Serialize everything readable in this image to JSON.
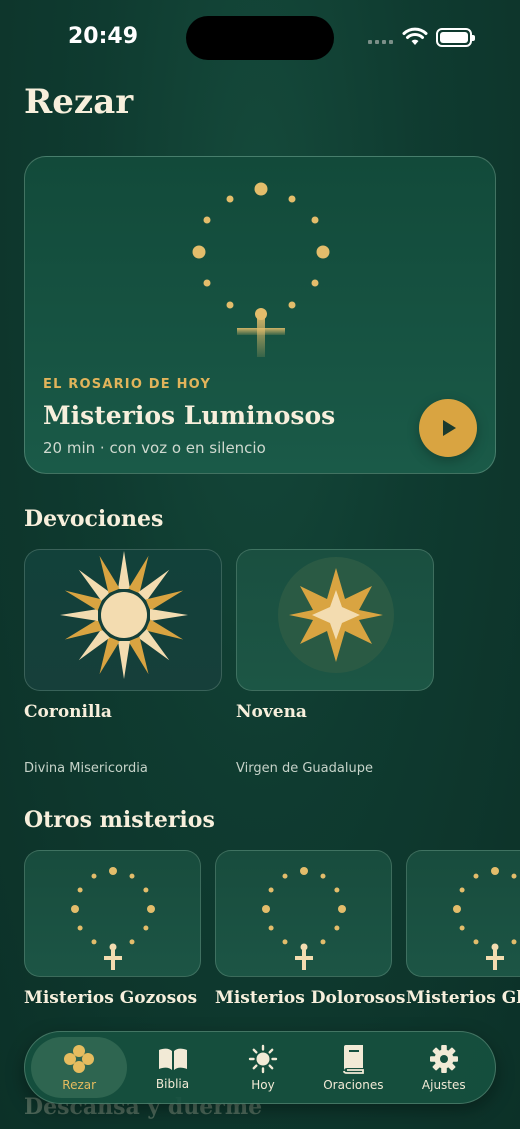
{
  "status_bar": {
    "time": "20:49"
  },
  "page": {
    "title": "Rezar"
  },
  "hero": {
    "kicker": "EL ROSARIO DE HOY",
    "title": "Misterios Luminosos",
    "subtitle": "20 min · con voz o en silencio",
    "play_icon": "play-icon"
  },
  "devociones": {
    "title": "Devociones",
    "items": [
      {
        "name": "Coronilla",
        "subtitle": "Divina Misericordia",
        "icon": "sunburst-icon"
      },
      {
        "name": "Novena",
        "subtitle": "Virgen de Guadalupe",
        "icon": "star-icon"
      }
    ]
  },
  "otros": {
    "title": "Otros misterios",
    "items": [
      {
        "name": "Misterios Gozosos"
      },
      {
        "name": "Misterios Dolorosos"
      },
      {
        "name": "Misterios Glo"
      }
    ]
  },
  "below_fold": {
    "title": "Descansa y duerme"
  },
  "tab_bar": {
    "items": [
      {
        "label": "Rezar",
        "icon": "rosary-beads-icon",
        "active": true
      },
      {
        "label": "Biblia",
        "icon": "book-open-icon",
        "active": false
      },
      {
        "label": "Hoy",
        "icon": "sun-icon",
        "active": false
      },
      {
        "label": "Oraciones",
        "icon": "prayer-book-icon",
        "active": false
      },
      {
        "label": "Ajustes",
        "icon": "gear-icon",
        "active": false
      }
    ]
  },
  "colors": {
    "accent": "#d9a441",
    "background": "#0f3b30",
    "text": "#f7efdc"
  }
}
